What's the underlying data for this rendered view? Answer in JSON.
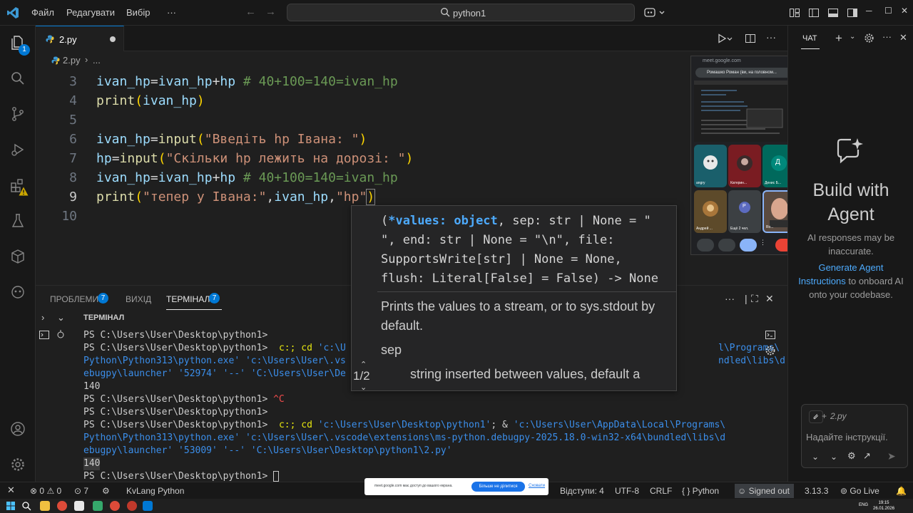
{
  "titlebar": {
    "menu": [
      "Файл",
      "Редагувати",
      "Вибір",
      "···"
    ],
    "search_text": "python1"
  },
  "activity": {
    "explorer_badge": "1"
  },
  "tab": {
    "label": "2.py"
  },
  "breadcrumb": {
    "file": "2.py",
    "sep": "›",
    "more": "..."
  },
  "editor": {
    "line_numbers": [
      "3",
      "4",
      "5",
      "6",
      "7",
      "8",
      "9",
      "10"
    ],
    "lines": {
      "l3": {
        "a": "ivan_hp",
        "b": "=",
        "c": "ivan_hp",
        "d": "+",
        "e": "hp",
        "f": " # 40+100=140=ivan_hp"
      },
      "l4": {
        "a": "print",
        "b": "(",
        "c": "ivan_hp",
        "d": ")"
      },
      "l6": {
        "a": "ivan_hp",
        "b": "=",
        "c": "input",
        "d": "(",
        "e": "\"Введіть hp Івана: \"",
        "f": ")"
      },
      "l7": {
        "a": "hp",
        "b": "=",
        "c": "input",
        "d": "(",
        "e": "\"Скільки hp лежить на дорозі: \"",
        "f": ")"
      },
      "l8": {
        "a": "ivan_hp",
        "b": "=",
        "c": "ivan_hp",
        "d": "+",
        "e": "hp",
        "f": " # 40+100=140=ivan_hp"
      },
      "l9": {
        "a": "print",
        "b": "(",
        "c": "\"тепер у Івана:\"",
        "d": ",",
        "e": "ivan_hp",
        "f": ",",
        "g": "\"hp\"",
        "h": ")"
      }
    }
  },
  "signature": {
    "code": "(*values: object, sep: str | None = \" \", end: str | None = \"\\n\", file: SupportsWrite[str] | None = None, flush: Literal[False] = False) -> None",
    "code_highlight": "*values: object",
    "doc": "Prints the values to a stream, or to sys.stdout by default.",
    "param": "sep",
    "param_desc": "string inserted between values, default a",
    "pager": "1/2",
    "up": "⌃",
    "down": "⌄"
  },
  "meet": {
    "url": "meet.google.com",
    "banner": "Ромашко Роман (ви, на головном...",
    "tiles": [
      "angry",
      "Катерин...",
      "Денис Б...",
      "Андрей ...",
      "Ещё 2 чел.",
      "Ro..."
    ],
    "tile_letters": [
      "",
      "",
      "Д",
      "",
      "P",
      ""
    ]
  },
  "panel": {
    "tabs": [
      "ПРОБЛЕМИ",
      "ВИХІД",
      "ТЕРМІНАЛ"
    ],
    "problems_badge": "7",
    "terminal_badge": "7",
    "terminal_title": "ТЕРМІНАЛ"
  },
  "terminal": {
    "l1": "PS C:\\Users\\User\\Desktop\\python1>",
    "l2a": "PS C:\\Users\\User\\Desktop\\python1>  ",
    "l2b": "c:; cd ",
    "l2c": "'c:\\U",
    "l2d": "l\\Programs\\",
    "l3a": "Python\\Python313\\python.exe' 'c:\\Users\\User\\.vs",
    "l3b": "ndled\\libs\\d",
    "l4a": "ebugpy\\launcher' '52974' '--' 'C:\\Users\\User\\De",
    "l5": "140",
    "l6a": "PS C:\\Users\\User\\Desktop\\python1> ",
    "l6b": "^C",
    "l7": "PS C:\\Users\\User\\Desktop\\python1>",
    "l8a": "PS C:\\Users\\User\\Desktop\\python1>  ",
    "l8b": "c:; cd ",
    "l8c": "'c:\\Users\\User\\Desktop\\python1'",
    "l8d": "; & ",
    "l8e": "'c:\\Users\\User\\AppData\\Local\\Programs\\",
    "l9": "Python\\Python313\\python.exe' 'c:\\Users\\User\\.vscode\\extensions\\ms-python.debugpy-2025.18.0-win32-x64\\bundled\\libs\\d",
    "l10": "ebugpy\\launcher' '53009' '--' 'C:\\Users\\User\\Desktop\\python1\\2.py'",
    "l11": "140",
    "l12": "PS C:\\Users\\User\\Desktop\\python1> "
  },
  "chat": {
    "tab": "ЧАТ",
    "title": "Build with Agent",
    "note": "AI responses may be inaccurate.",
    "link": "Generate Agent Instructions",
    "link_tail": " to onboard AI onto your codebase.",
    "context": "2.py",
    "placeholder": "Надайте інструкції."
  },
  "status": {
    "errors": "0",
    "warnings": "0",
    "ports": "7",
    "kvlang": "KvLang Python",
    "indent": "Відступи: 4",
    "encoding": "UTF-8",
    "eol": "CRLF",
    "lang": "{ } Python",
    "signed": "Signed out",
    "version": "3.13.3",
    "golive": "Go Live"
  },
  "share": {
    "text": "meet.google.com має доступ до вашого екрана.",
    "button": "Більше не ділитися",
    "hide": "Сховати"
  },
  "taskbar": {
    "lang": "ENG",
    "time": "19:15",
    "date": "26.01.2026"
  },
  "colors": {
    "accent": "#0078d4",
    "bg": "#1f1f1f",
    "keyword_var": "#9cdcfe",
    "function": "#dcdcaa",
    "string": "#ce9178",
    "comment": "#6a9955"
  }
}
